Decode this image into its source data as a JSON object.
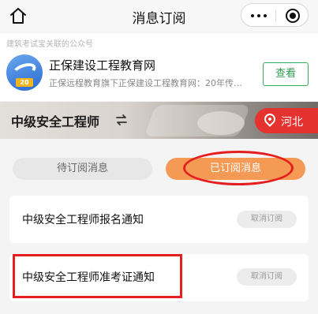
{
  "nav": {
    "title": "消息订阅",
    "home_icon": "home-icon",
    "more_icon": "more-dots-icon",
    "close_icon": "target-icon"
  },
  "account": {
    "note": "建筑考试宝关联的公众号",
    "logo_badge": "20",
    "name": "正保建设工程教育网",
    "description": "正保远程教育旗下正保建设工程教育网：20年传…",
    "view_label": "查看",
    "view_color": "#2e9d4f"
  },
  "banner": {
    "title": "中级安全工程师",
    "swap_icon": "swap-arrows-icon",
    "region": "河北",
    "region_icon": "location-pin-icon",
    "region_color": "#e5322f"
  },
  "tabs": [
    {
      "label": "待订阅消息",
      "active": false
    },
    {
      "label": "已订阅消息",
      "active": true
    }
  ],
  "accent_color": "#f59a55",
  "subscriptions": [
    {
      "title": "中级安全工程师报名通知",
      "action": "取消订阅"
    },
    {
      "title": "中级安全工程师准考证通知",
      "action": "取消订阅"
    }
  ]
}
